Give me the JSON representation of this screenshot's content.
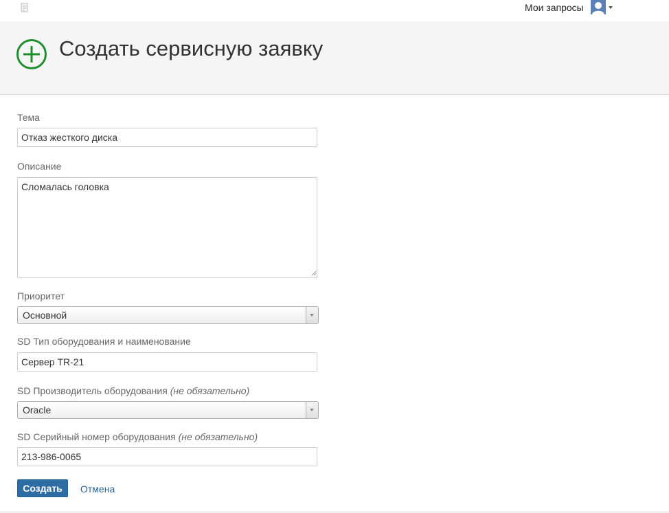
{
  "topbar": {
    "logo_icon": "document-icon",
    "my_requests_label": "Мои запросы",
    "avatar_icon": "user-avatar-icon"
  },
  "header": {
    "title": "Создать сервисную заявку",
    "icon": "plus-circle-icon",
    "icon_color": "#1f8f2e"
  },
  "form": {
    "subject": {
      "label": "Тема",
      "value": "Отказ жесткого диска"
    },
    "description": {
      "label": "Описание",
      "value": "Сломалась головка"
    },
    "priority": {
      "label": "Приоритет",
      "value": "Основной"
    },
    "equipment_type": {
      "label": "SD Тип оборудования и наименование",
      "value": "Сервер TR-21"
    },
    "manufacturer": {
      "label": "SD Производитель оборудования",
      "optional": "(не обязательно)",
      "value": "Oracle"
    },
    "serial_number": {
      "label": "SD Серийный номер оборудования",
      "optional": "(не обязательно)",
      "value": "213-986-0065"
    }
  },
  "actions": {
    "submit_label": "Создать",
    "cancel_label": "Отмена",
    "primary_color": "#2e6da4"
  }
}
